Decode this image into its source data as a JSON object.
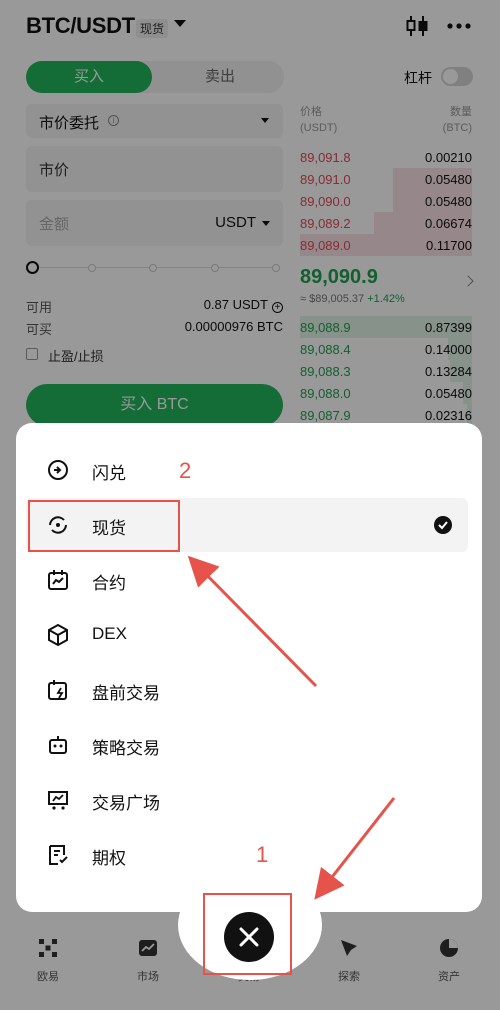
{
  "header": {
    "pair": "BTC/USDT",
    "badge": "现货",
    "icons": [
      "candlestick-icon",
      "more-icon"
    ]
  },
  "trade": {
    "tab_buy": "买入",
    "tab_sell": "卖出",
    "leverage_label": "杠杆",
    "leverage_on": false,
    "order_type": "市价委托",
    "market_label": "市价",
    "amount_placeholder": "金额",
    "amount_unit": "USDT",
    "slider_percent": 0,
    "available_label": "可用",
    "available_value": "0.87 USDT",
    "buyable_label": "可买",
    "buyable_value": "0.00000976 BTC",
    "tpsl_label": "止盈/止损",
    "buy_button": "买入 BTC"
  },
  "orderbook": {
    "price_header": "价格",
    "price_unit": "(USDT)",
    "qty_header": "数量",
    "qty_unit": "(BTC)",
    "asks": [
      {
        "price": "89,091.8",
        "qty": "0.00210",
        "depth": 0.0
      },
      {
        "price": "89,091.0",
        "qty": "0.05480",
        "depth": 0.46
      },
      {
        "price": "89,090.0",
        "qty": "0.05480",
        "depth": 0.46
      },
      {
        "price": "89,089.2",
        "qty": "0.06674",
        "depth": 0.57
      },
      {
        "price": "89,089.0",
        "qty": "0.11700",
        "depth": 1.0
      }
    ],
    "mid_price": "89,090.9",
    "mid_sub_usd": "≈ $89,005.37",
    "mid_sub_change": "+1.42%",
    "bids": [
      {
        "price": "89,088.9",
        "qty": "0.87399",
        "depth": 1.0
      },
      {
        "price": "89,088.4",
        "qty": "0.14000",
        "depth": 0.14
      },
      {
        "price": "89,088.3",
        "qty": "0.13284",
        "depth": 0.13
      },
      {
        "price": "89,088.0",
        "qty": "0.05480",
        "depth": 0.05
      },
      {
        "price": "89,087.9",
        "qty": "0.02316",
        "depth": 0.03
      }
    ]
  },
  "menu": {
    "items": [
      {
        "label": "闪兑",
        "icon": "swap-icon",
        "selected": false
      },
      {
        "label": "现货",
        "icon": "spot-icon",
        "selected": true
      },
      {
        "label": "合约",
        "icon": "futures-icon",
        "selected": false
      },
      {
        "label": "DEX",
        "icon": "dex-icon",
        "selected": false
      },
      {
        "label": "盘前交易",
        "icon": "premarket-icon",
        "selected": false
      },
      {
        "label": "策略交易",
        "icon": "bot-icon",
        "selected": false
      },
      {
        "label": "交易广场",
        "icon": "trading-square-icon",
        "selected": false
      },
      {
        "label": "期权",
        "icon": "options-icon",
        "selected": false
      }
    ]
  },
  "bottom_nav": {
    "items": [
      {
        "label": "欧易",
        "icon": "okx-logo-icon"
      },
      {
        "label": "市场",
        "icon": "market-icon"
      },
      {
        "label": "交易",
        "icon": "trade-icon"
      },
      {
        "label": "探索",
        "icon": "explore-icon"
      },
      {
        "label": "资产",
        "icon": "assets-icon"
      }
    ]
  },
  "annotations": {
    "step1": "1",
    "step2": "2",
    "color": "#e5534b"
  },
  "colors": {
    "buy_green": "#22b45a",
    "ask_red": "#e5485b"
  }
}
